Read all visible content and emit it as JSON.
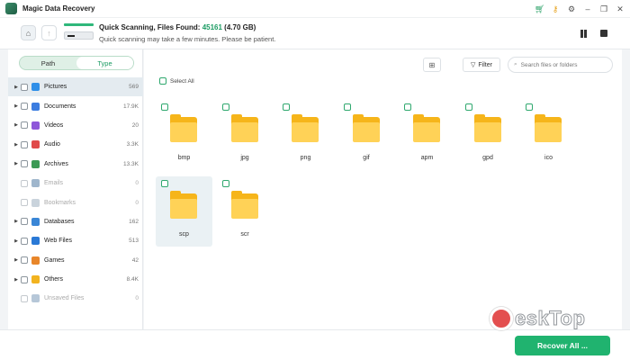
{
  "app": {
    "title": "Magic Data Recovery"
  },
  "scan": {
    "title_prefix": "Quick Scanning, Files Found: ",
    "files_found": "45161",
    "size": " (4.70 GB)",
    "subtitle": "Quick scanning may take a few minutes. Please be patient."
  },
  "sidebar": {
    "toggle": {
      "path": "Path",
      "type": "Type",
      "active": "Type"
    },
    "categories": [
      {
        "name": "Pictures",
        "count": "569",
        "color": "#2f8fe8",
        "icon": "pictures-icon",
        "selected": true,
        "expandable": true,
        "dim": false
      },
      {
        "name": "Documents",
        "count": "17.9K",
        "color": "#3b7de0",
        "icon": "documents-icon",
        "selected": false,
        "expandable": true,
        "dim": false
      },
      {
        "name": "Videos",
        "count": "20",
        "color": "#8e57d9",
        "icon": "videos-icon",
        "selected": false,
        "expandable": true,
        "dim": false
      },
      {
        "name": "Audio",
        "count": "3.3K",
        "color": "#e04a4a",
        "icon": "audio-icon",
        "selected": false,
        "expandable": true,
        "dim": false
      },
      {
        "name": "Archives",
        "count": "13.3K",
        "color": "#3c9a55",
        "icon": "archives-icon",
        "selected": false,
        "expandable": true,
        "dim": false
      },
      {
        "name": "Emails",
        "count": "0",
        "color": "#9fb6cc",
        "icon": "emails-icon",
        "selected": false,
        "expandable": false,
        "dim": true
      },
      {
        "name": "Bookmarks",
        "count": "0",
        "color": "#c9d3dc",
        "icon": "bookmarks-icon",
        "selected": false,
        "expandable": false,
        "dim": true
      },
      {
        "name": "Databases",
        "count": "162",
        "color": "#3a86d6",
        "icon": "databases-icon",
        "selected": false,
        "expandable": true,
        "dim": false
      },
      {
        "name": "Web Files",
        "count": "513",
        "color": "#2a79d6",
        "icon": "web-files-icon",
        "selected": false,
        "expandable": true,
        "dim": false
      },
      {
        "name": "Games",
        "count": "42",
        "color": "#e8862a",
        "icon": "games-icon",
        "selected": false,
        "expandable": true,
        "dim": false
      },
      {
        "name": "Others",
        "count": "8.4K",
        "color": "#f2b31f",
        "icon": "others-icon",
        "selected": false,
        "expandable": true,
        "dim": false
      },
      {
        "name": "Unsaved Files",
        "count": "0",
        "color": "#b6c7d8",
        "icon": "unsaved-files-icon",
        "selected": false,
        "expandable": false,
        "dim": true
      }
    ]
  },
  "toolbar": {
    "filter_label": "Filter",
    "search_placeholder": "Search files or folders"
  },
  "main": {
    "select_all": "Select All",
    "folders": [
      {
        "name": "bmp",
        "selected": false
      },
      {
        "name": "jpg",
        "selected": false
      },
      {
        "name": "png",
        "selected": false
      },
      {
        "name": "gif",
        "selected": false
      },
      {
        "name": "apm",
        "selected": false
      },
      {
        "name": "gpd",
        "selected": false
      },
      {
        "name": "ico",
        "selected": false
      },
      {
        "name": "scp",
        "selected": true
      },
      {
        "name": "scr",
        "selected": false
      }
    ]
  },
  "footer": {
    "recover_label": "Recover All ..."
  },
  "watermark": {
    "text": "eskTop"
  },
  "colors": {
    "accent": "#20b36f",
    "folder": "#f6b51a"
  }
}
